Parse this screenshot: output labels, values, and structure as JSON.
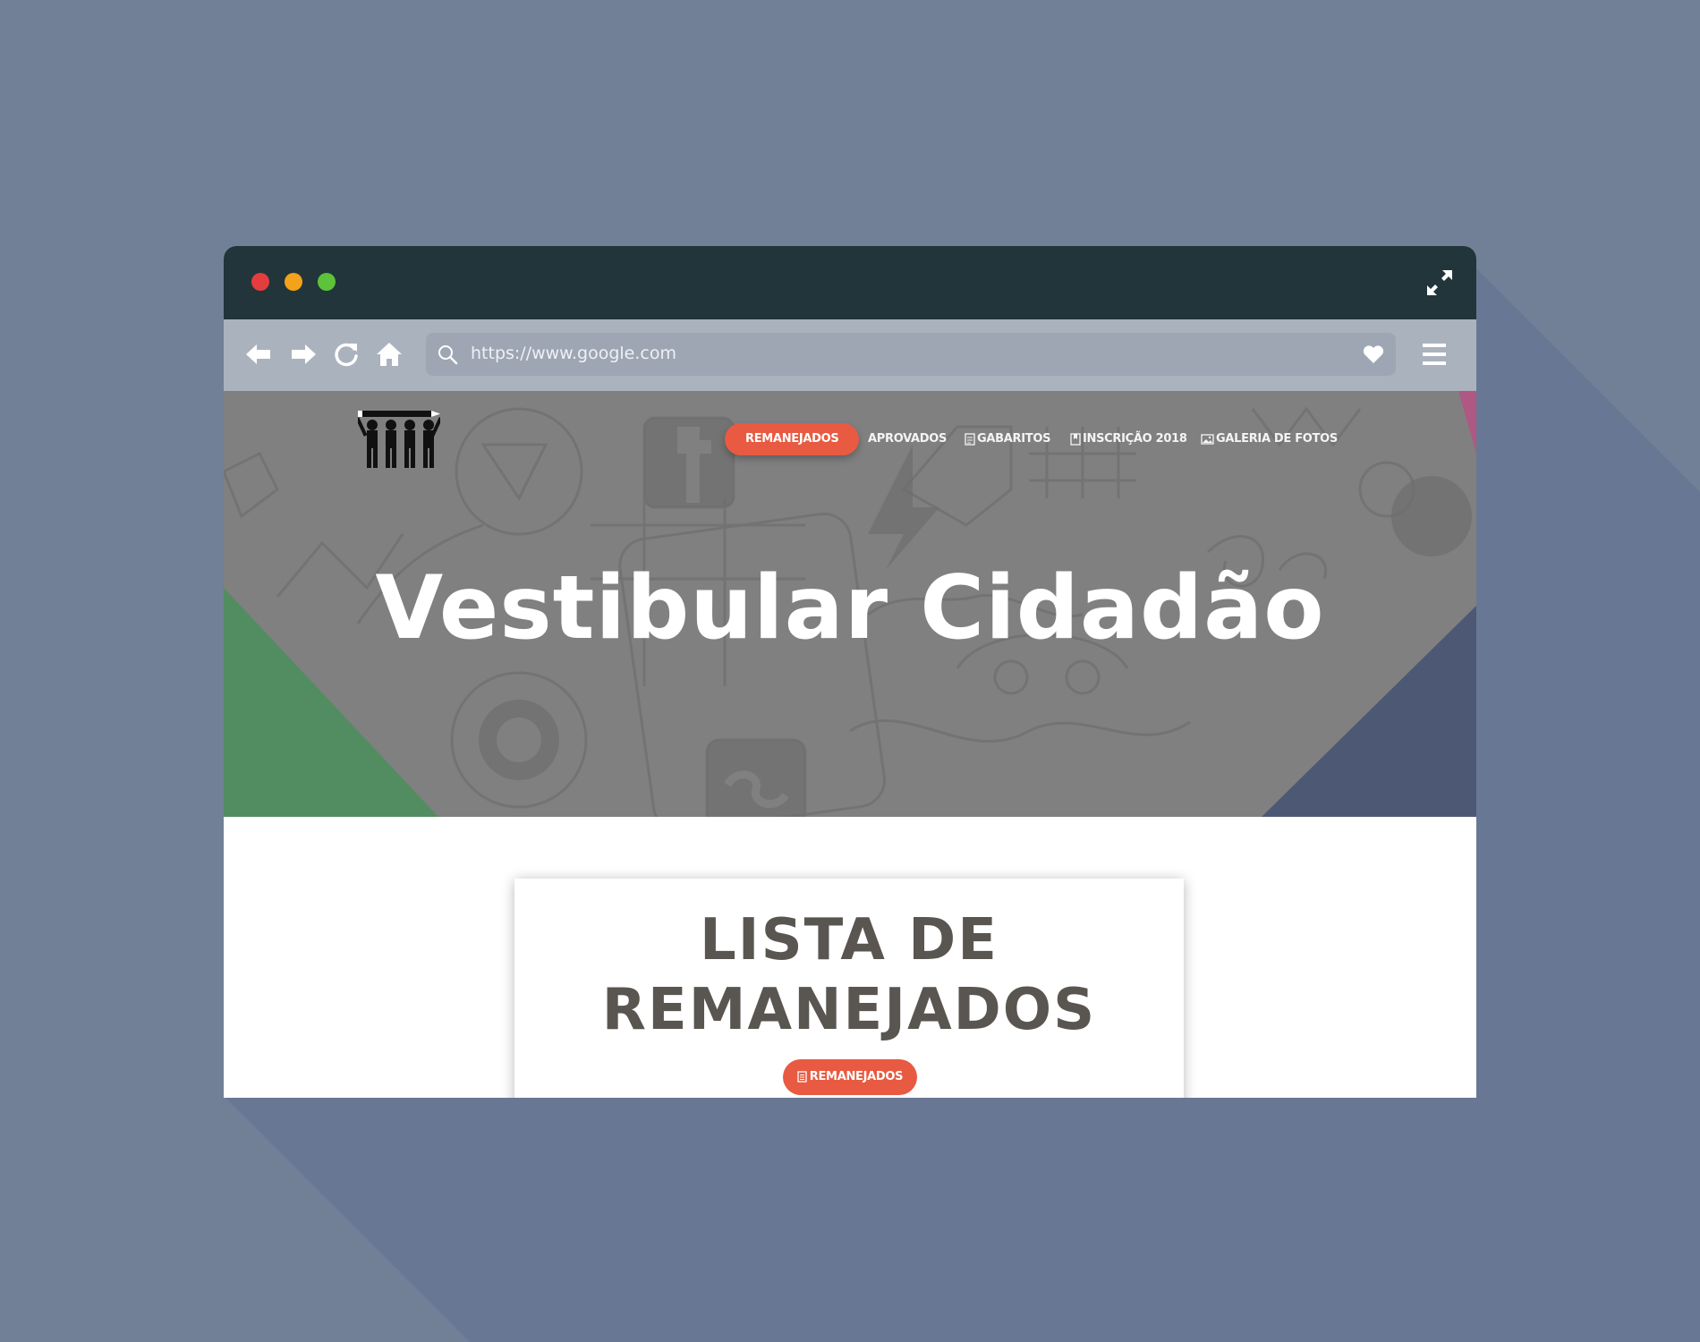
{
  "browser": {
    "window_buttons": [
      "close",
      "minimize",
      "maximize"
    ],
    "expand_icon": "expand-arrows-icon",
    "nav_icons": [
      "back-arrow-icon",
      "forward-arrow-icon",
      "reload-icon",
      "home-icon"
    ],
    "url": "https://www.google.com",
    "bookmark_icon": "heart-icon",
    "menu_icon": "hamburger-menu-icon"
  },
  "site": {
    "logo_icon": "people-holding-pencil-logo",
    "nav": [
      {
        "label": "REMANEJADOS",
        "active": true
      },
      {
        "label": "APROVADOS",
        "active": false
      },
      {
        "label": "GABARITOS",
        "icon": "document-icon"
      },
      {
        "label": "INSCRIÇÃO 2018",
        "icon": "bookmark-icon"
      },
      {
        "label": "GALERIA DE FOTOS",
        "icon": "image-icon"
      }
    ],
    "hero_title": "Vestibular Cidadão",
    "card": {
      "title_line1": "LISTA DE",
      "title_line2": "REMANEJADOS",
      "button_label": "REMANEJADOS",
      "button_icon": "list-icon"
    }
  },
  "colors": {
    "page_background": "#717f97",
    "titlebar": "#22353a",
    "toolbar": "#aab2be",
    "accent": "#e85a41",
    "hero_overlay": "#808080",
    "card_title": "#595550"
  }
}
